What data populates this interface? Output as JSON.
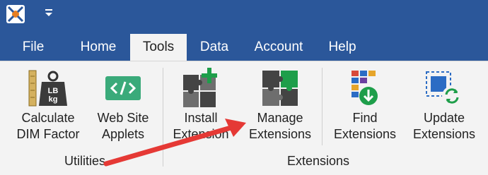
{
  "tabs": [
    "File",
    "Home",
    "Tools",
    "Data",
    "Account",
    "Help"
  ],
  "active_tab": "Tools",
  "buttons": {
    "calc_dim": "Calculate\nDIM Factor",
    "web_applets": "Web Site\nApplets",
    "install_ext": "Install\nExtension",
    "manage_ext": "Manage\nExtensions",
    "find_ext": "Find\nExtensions",
    "update_ext": "Update\nExtensions"
  },
  "groups": {
    "utilities": "Utilities",
    "extensions": "Extensions"
  },
  "icon_labels": {
    "weight_top": "LB",
    "weight_bottom": "kg"
  },
  "colors": {
    "brand": "#2b579a",
    "accent_green": "#1e9e4a",
    "annotation_arrow": "#e53935"
  }
}
